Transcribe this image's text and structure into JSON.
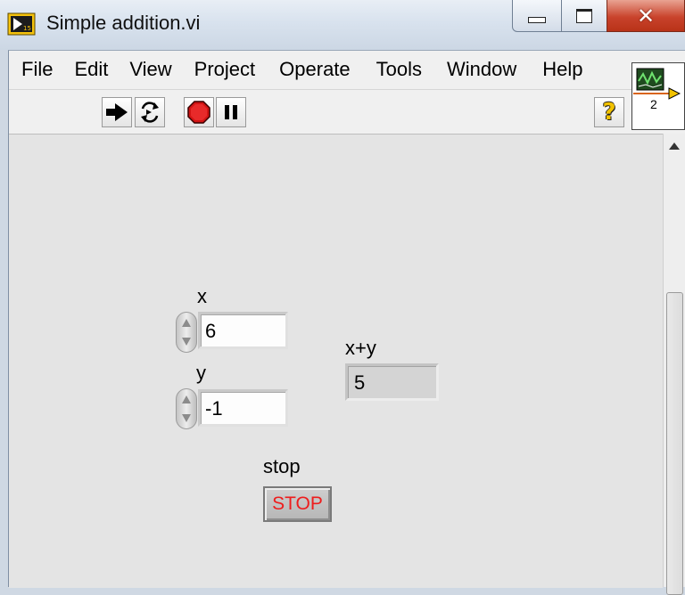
{
  "window": {
    "title": "Simple addition.vi",
    "close_glyph": "✕"
  },
  "menu": {
    "items": [
      "File",
      "Edit",
      "View",
      "Project",
      "Operate",
      "Tools",
      "Window",
      "Help"
    ]
  },
  "toolbar": {
    "icons": [
      "run-arrow-icon",
      "run-continuously-icon",
      "abort-icon",
      "pause-icon",
      "context-help-icon"
    ],
    "help_glyph": "?"
  },
  "vi_icon": {
    "number": "2"
  },
  "controls": {
    "x": {
      "label": "x",
      "value": "6"
    },
    "y": {
      "label": "y",
      "value": "-1"
    },
    "sum": {
      "label": "x+y",
      "value": "5"
    },
    "stop": {
      "label": "stop",
      "button_text": "STOP"
    }
  },
  "colors": {
    "stop_text": "#ee1c1c",
    "close_button": "#c9432c",
    "panel_bg": "#e4e4e4"
  }
}
